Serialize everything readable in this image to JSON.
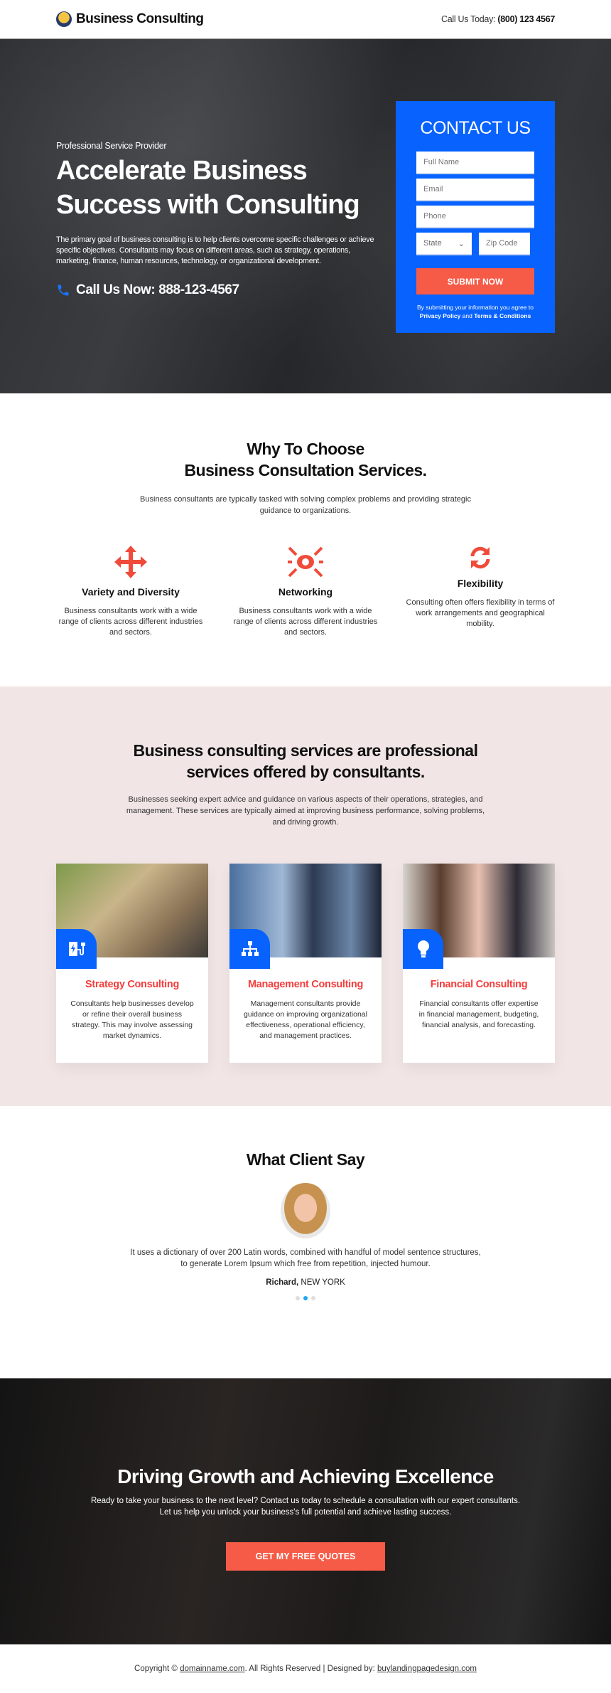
{
  "header": {
    "brand": "Business Consulting",
    "call_label": "Call Us Today:",
    "call_number": "(800) 123 4567"
  },
  "hero": {
    "tagline": "Professional Service Provider",
    "headline": "Accelerate Business Success with Consulting",
    "paragraph": "The primary goal of business consulting is to help clients overcome specific challenges or achieve specific objectives. Consultants may focus on different areas, such as strategy, operations, marketing, finance, human resources, technology, or organizational development.",
    "call_now": "Call Us Now: 888-123-4567"
  },
  "form": {
    "title": "CONTACT US",
    "full_name": "Full Name",
    "email": "Email",
    "phone": "Phone",
    "state": "State",
    "zip": "Zip Code",
    "submit": "SUBMIT NOW",
    "fine_1": "By submitting your information you agree to ",
    "privacy": "Privacy Policy",
    "and": " and ",
    "terms": "Terms & Conditions"
  },
  "why": {
    "title_1": "Why To Choose",
    "title_2": "Business Consultation Services.",
    "subtitle": "Business consultants are typically tasked with solving complex problems and providing strategic guidance to organizations.",
    "features": [
      {
        "icon": "arrows-move-icon",
        "title": "Variety and Diversity",
        "desc": "Business consultants work with a wide range of clients across different industries and sectors."
      },
      {
        "icon": "networking-icon",
        "title": "Networking",
        "desc": "Business consultants work with a wide range of clients across different industries and sectors."
      },
      {
        "icon": "refresh-icon",
        "title": "Flexibility",
        "desc": "Consulting often offers flexibility in terms of work arrangements and geographical mobility."
      }
    ]
  },
  "services": {
    "title": "Business consulting services are professional services offered by consultants.",
    "subtitle": "Businesses seeking expert advice and guidance on various aspects of their operations, strategies, and management. These services are typically aimed at improving business performance, solving problems, and driving growth.",
    "cards": [
      {
        "icon": "charging-station-icon",
        "title": "Strategy Consulting",
        "desc": "Consultants help businesses develop or refine their overall business strategy. This may involve assessing market dynamics."
      },
      {
        "icon": "org-chart-icon",
        "title": "Management Consulting",
        "desc": "Management consultants provide guidance on improving organizational effectiveness, operational efficiency, and management practices."
      },
      {
        "icon": "lightbulb-icon",
        "title": "Financial Consulting",
        "desc": "Financial consultants offer expertise in financial management, budgeting, financial analysis, and forecasting."
      }
    ]
  },
  "testimonial": {
    "title": "What Client Say",
    "quote": "It uses a dictionary of over 200 Latin words, combined with handful of model sentence structures, to generate Lorem Ipsum which free from repetition, injected humour.",
    "name": "Richard,",
    "location": " NEW YORK",
    "active_slide": 2,
    "slides": 3
  },
  "cta": {
    "title": "Driving Growth and Achieving Excellence",
    "text_1": "Ready to take your business to the next level? Contact us today to schedule a consultation with our expert consultants.",
    "text_2": "Let us help you unlock your business's full potential and achieve lasting success.",
    "button": "GET MY FREE QUOTES"
  },
  "footer": {
    "copyright": "Copyright © ",
    "domain": "domainname.com",
    "rights": ". All Rights Reserved | Designed by: ",
    "designer": "buylandingpagedesign.com"
  },
  "colors": {
    "primary": "#0862fd",
    "accent": "#f55b47",
    "heading_red": "#f53d3d",
    "services_bg": "#f1e5e5"
  }
}
